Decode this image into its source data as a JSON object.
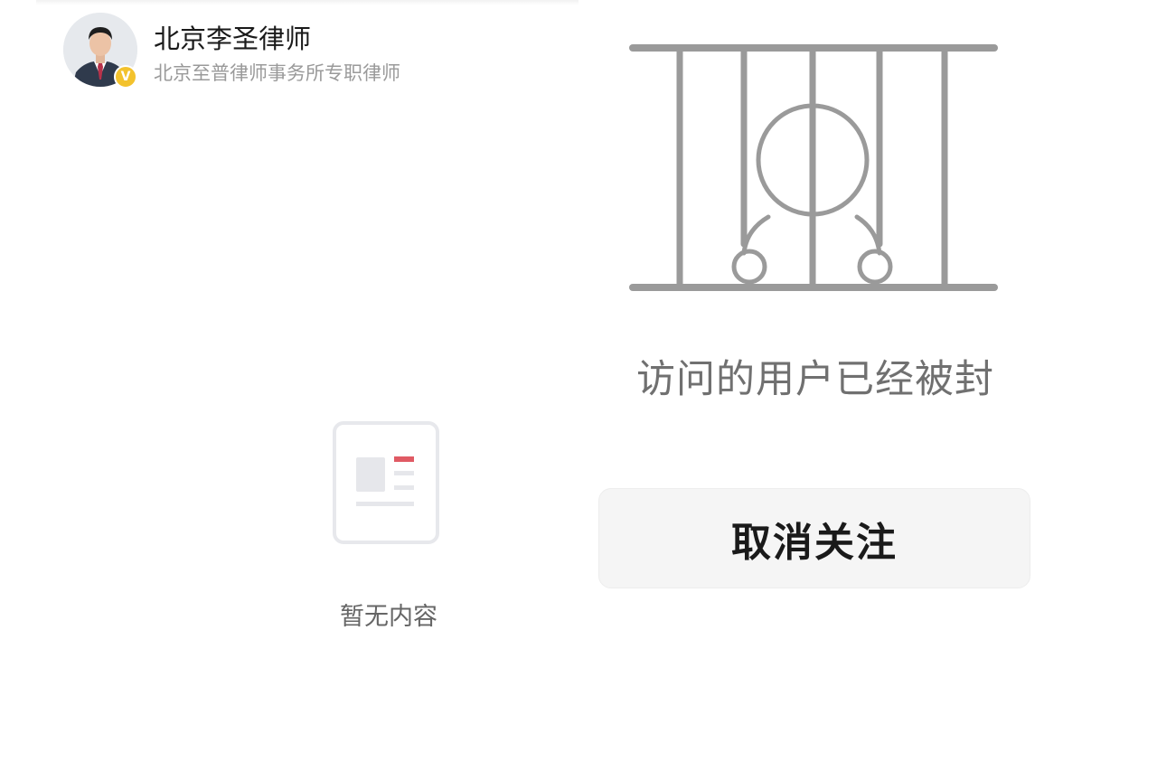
{
  "profile": {
    "name": "北京李圣律师",
    "subtitle": "北京至普律师事务所专职律师",
    "badge": "V",
    "badge_color": "#f3c22d"
  },
  "empty_state": {
    "icon": "article-placeholder-icon",
    "text": "暂无内容",
    "accent_color": "#e05a64"
  },
  "ban_notice": {
    "icon": "jail-bars-icon",
    "message": "访问的用户已经被封",
    "button_label": "取消关注"
  }
}
